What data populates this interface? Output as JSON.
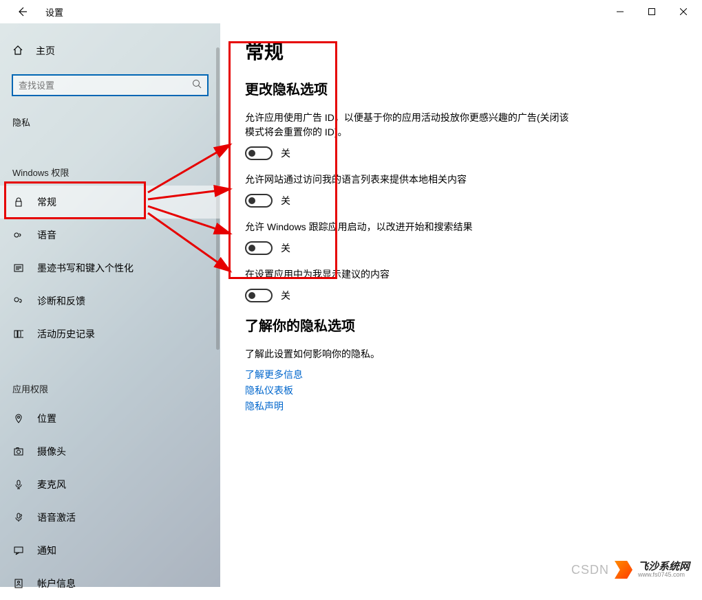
{
  "titlebar": {
    "title": "设置"
  },
  "sidebar": {
    "home": "主页",
    "search_placeholder": "查找设置",
    "category": "隐私",
    "group1": "Windows 权限",
    "items1": [
      {
        "label": "常规"
      },
      {
        "label": "语音"
      },
      {
        "label": "墨迹书写和键入个性化"
      },
      {
        "label": "诊断和反馈"
      },
      {
        "label": "活动历史记录"
      }
    ],
    "group2": "应用权限",
    "items2": [
      {
        "label": "位置"
      },
      {
        "label": "摄像头"
      },
      {
        "label": "麦克风"
      },
      {
        "label": "语音激活"
      },
      {
        "label": "通知"
      },
      {
        "label": "帐户信息"
      }
    ]
  },
  "content": {
    "page_title": "常规",
    "section1": "更改隐私选项",
    "toggles": [
      {
        "desc": "允许应用使用广告 ID，以便基于你的应用活动投放你更感兴趣的广告(关闭该模式将会重置你的 ID)。",
        "state": "关"
      },
      {
        "desc": "允许网站通过访问我的语言列表来提供本地相关内容",
        "state": "关"
      },
      {
        "desc": "允许 Windows 跟踪应用启动，以改进开始和搜索结果",
        "state": "关"
      },
      {
        "desc": "在设置应用中为我显示建议的内容",
        "state": "关"
      }
    ],
    "section2": "了解你的隐私选项",
    "info": "了解此设置如何影响你的隐私。",
    "links": [
      "了解更多信息",
      "隐私仪表板",
      "隐私声明"
    ]
  },
  "watermark": {
    "csdn": "CSDN",
    "brand": "飞沙系统网",
    "url": "www.fs0745.com"
  }
}
